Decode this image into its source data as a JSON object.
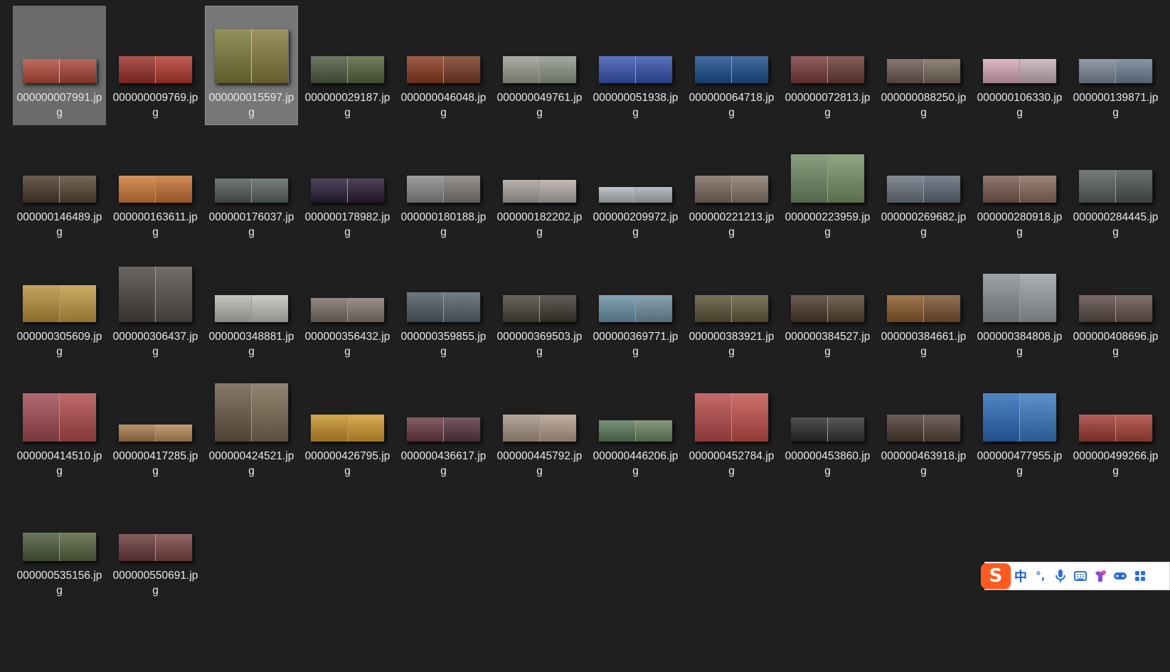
{
  "files": [
    {
      "name": "000000007991.jpg",
      "thumb": {
        "w": 104,
        "h": 34,
        "colors": [
          "#b34a3b",
          "#a94536"
        ]
      }
    },
    {
      "name": "000000009769.jpg",
      "thumb": {
        "w": 104,
        "h": 38,
        "colors": [
          "#9a2f2a",
          "#b43a2f"
        ]
      }
    },
    {
      "name": "000000015597.jpg",
      "thumb": {
        "w": 104,
        "h": 76,
        "colors": [
          "#7c7a3a",
          "#857c3e"
        ]
      }
    },
    {
      "name": "000000029187.jpg",
      "thumb": {
        "w": 104,
        "h": 38,
        "colors": [
          "#4f5a42",
          "#57633d"
        ]
      }
    },
    {
      "name": "000000046048.jpg",
      "thumb": {
        "w": 104,
        "h": 38,
        "colors": [
          "#8a3a22",
          "#7a3a25"
        ]
      }
    },
    {
      "name": "000000049761.jpg",
      "thumb": {
        "w": 104,
        "h": 38,
        "colors": [
          "#9c9d90",
          "#909688"
        ]
      }
    },
    {
      "name": "000000051938.jpg",
      "thumb": {
        "w": 104,
        "h": 38,
        "colors": [
          "#3954b2",
          "#3552ae"
        ]
      }
    },
    {
      "name": "000000064718.jpg",
      "thumb": {
        "w": 104,
        "h": 38,
        "colors": [
          "#1b4f8e",
          "#1c4f8e"
        ]
      }
    },
    {
      "name": "000000072813.jpg",
      "thumb": {
        "w": 104,
        "h": 38,
        "colors": [
          "#7a3b3b",
          "#6b3b35"
        ]
      }
    },
    {
      "name": "000000088250.jpg",
      "thumb": {
        "w": 104,
        "h": 34,
        "colors": [
          "#6c5a50",
          "#786a5c"
        ]
      }
    },
    {
      "name": "000000106330.jpg",
      "thumb": {
        "w": 104,
        "h": 34,
        "colors": [
          "#d7a7b8",
          "#c7b0b8"
        ]
      }
    },
    {
      "name": "000000139871.jpg",
      "thumb": {
        "w": 104,
        "h": 34,
        "colors": [
          "#7a8796",
          "#6e8094"
        ]
      }
    },
    {
      "name": "000000146489.jpg",
      "thumb": {
        "w": 104,
        "h": 38,
        "colors": [
          "#4b3a2a",
          "#5a4634"
        ]
      }
    },
    {
      "name": "000000163611.jpg",
      "thumb": {
        "w": 104,
        "h": 38,
        "colors": [
          "#cf7a3a",
          "#c77234"
        ]
      }
    },
    {
      "name": "000000176037.jpg",
      "thumb": {
        "w": 104,
        "h": 34,
        "colors": [
          "#525a56",
          "#5a6460"
        ]
      }
    },
    {
      "name": "000000178982.jpg",
      "thumb": {
        "w": 104,
        "h": 34,
        "colors": [
          "#2a1e3a",
          "#2a1c33"
        ]
      }
    },
    {
      "name": "000000180188.jpg",
      "thumb": {
        "w": 104,
        "h": 38,
        "colors": [
          "#8a8886",
          "#7f7b78"
        ]
      }
    },
    {
      "name": "000000182202.jpg",
      "thumb": {
        "w": 104,
        "h": 32,
        "colors": [
          "#a9a29c",
          "#b4aca6"
        ]
      }
    },
    {
      "name": "000000209972.jpg",
      "thumb": {
        "w": 104,
        "h": 22,
        "colors": [
          "#b3b8bd",
          "#aab0b6"
        ]
      }
    },
    {
      "name": "000000221213.jpg",
      "thumb": {
        "w": 104,
        "h": 38,
        "colors": [
          "#7b6a5e",
          "#86776a"
        ]
      }
    },
    {
      "name": "000000223959.jpg",
      "thumb": {
        "w": 104,
        "h": 68,
        "colors": [
          "#6e8a64",
          "#789266"
        ]
      }
    },
    {
      "name": "000000269682.jpg",
      "thumb": {
        "w": 104,
        "h": 38,
        "colors": [
          "#6a7380",
          "#5e6876"
        ]
      }
    },
    {
      "name": "000000280918.jpg",
      "thumb": {
        "w": 104,
        "h": 38,
        "colors": [
          "#7a5b4f",
          "#8a6a5a"
        ]
      }
    },
    {
      "name": "000000284445.jpg",
      "thumb": {
        "w": 104,
        "h": 46,
        "colors": [
          "#5a5f5c",
          "#4e5450"
        ]
      }
    },
    {
      "name": "000000305609.jpg",
      "thumb": {
        "w": 104,
        "h": 52,
        "colors": [
          "#b8903a",
          "#c49a44"
        ]
      }
    },
    {
      "name": "000000306437.jpg",
      "thumb": {
        "w": 104,
        "h": 78,
        "colors": [
          "#4a4440",
          "#54504b"
        ]
      }
    },
    {
      "name": "000000348881.jpg",
      "thumb": {
        "w": 104,
        "h": 38,
        "colors": [
          "#b8b6b0",
          "#c2c0ba"
        ]
      }
    },
    {
      "name": "000000356432.jpg",
      "thumb": {
        "w": 104,
        "h": 34,
        "colors": [
          "#7a6e66",
          "#847870"
        ]
      }
    },
    {
      "name": "000000359855.jpg",
      "thumb": {
        "w": 104,
        "h": 42,
        "colors": [
          "#4f5c64",
          "#55626a"
        ]
      }
    },
    {
      "name": "000000369503.jpg",
      "thumb": {
        "w": 104,
        "h": 38,
        "colors": [
          "#4a4438",
          "#3e3a32"
        ]
      }
    },
    {
      "name": "000000369771.jpg",
      "thumb": {
        "w": 104,
        "h": 38,
        "colors": [
          "#6a92a8",
          "#7090a0"
        ]
      }
    },
    {
      "name": "000000383921.jpg",
      "thumb": {
        "w": 104,
        "h": 38,
        "colors": [
          "#5c5236",
          "#645a3a"
        ]
      }
    },
    {
      "name": "000000384527.jpg",
      "thumb": {
        "w": 104,
        "h": 38,
        "colors": [
          "#4a3a2a",
          "#56442f"
        ]
      }
    },
    {
      "name": "000000384661.jpg",
      "thumb": {
        "w": 104,
        "h": 38,
        "colors": [
          "#8a5a2a",
          "#7a5230"
        ]
      }
    },
    {
      "name": "000000384808.jpg",
      "thumb": {
        "w": 104,
        "h": 68,
        "colors": [
          "#8a8e94",
          "#9a9ea4"
        ]
      }
    },
    {
      "name": "000000408696.jpg",
      "thumb": {
        "w": 104,
        "h": 38,
        "colors": [
          "#5a4a44",
          "#64524a"
        ]
      }
    },
    {
      "name": "000000414510.jpg",
      "thumb": {
        "w": 104,
        "h": 68,
        "colors": [
          "#a04a52",
          "#b04a4a"
        ]
      }
    },
    {
      "name": "000000417285.jpg",
      "thumb": {
        "w": 104,
        "h": 24,
        "colors": [
          "#a87a4a",
          "#b68a58"
        ]
      }
    },
    {
      "name": "000000424521.jpg",
      "thumb": {
        "w": 104,
        "h": 82,
        "colors": [
          "#6a5a46",
          "#7a6a52"
        ]
      }
    },
    {
      "name": "000000426795.jpg",
      "thumb": {
        "w": 104,
        "h": 38,
        "colors": [
          "#c8922a",
          "#d49a30"
        ]
      }
    },
    {
      "name": "000000436617.jpg",
      "thumb": {
        "w": 104,
        "h": 34,
        "colors": [
          "#6a3a44",
          "#5a3440"
        ]
      }
    },
    {
      "name": "000000445792.jpg",
      "thumb": {
        "w": 104,
        "h": 38,
        "colors": [
          "#a89484",
          "#b49e8c"
        ]
      }
    },
    {
      "name": "000000446206.jpg",
      "thumb": {
        "w": 104,
        "h": 30,
        "colors": [
          "#5a7a5a",
          "#6a8460"
        ]
      }
    },
    {
      "name": "000000452784.jpg",
      "thumb": {
        "w": 104,
        "h": 68,
        "colors": [
          "#b84a4a",
          "#c2504a"
        ]
      }
    },
    {
      "name": "000000453860.jpg",
      "thumb": {
        "w": 104,
        "h": 34,
        "colors": [
          "#2a2a2a",
          "#333"
        ]
      }
    },
    {
      "name": "000000463918.jpg",
      "thumb": {
        "w": 104,
        "h": 38,
        "colors": [
          "#4a3a30",
          "#54443a"
        ]
      }
    },
    {
      "name": "000000477955.jpg",
      "thumb": {
        "w": 104,
        "h": 68,
        "colors": [
          "#2a6ab8",
          "#3a78c0"
        ]
      }
    },
    {
      "name": "000000499266.jpg",
      "thumb": {
        "w": 104,
        "h": 38,
        "colors": [
          "#a03a34",
          "#aa4238"
        ]
      }
    },
    {
      "name": "000000535156.jpg",
      "thumb": {
        "w": 104,
        "h": 40,
        "colors": [
          "#4a5a3a",
          "#566440"
        ]
      }
    },
    {
      "name": "000000550691.jpg",
      "thumb": {
        "w": 104,
        "h": 38,
        "colors": [
          "#6a3a3a",
          "#7a4444"
        ]
      }
    }
  ],
  "selected_indices": [
    0,
    2
  ],
  "ime_toolbar": {
    "logo": "S",
    "mode": "中",
    "punct": "°,",
    "icons": [
      "microphone-icon",
      "keyboard-icon",
      "skin-icon",
      "gamepad-icon",
      "grid-icon"
    ],
    "accent": "#ff5a1f"
  }
}
